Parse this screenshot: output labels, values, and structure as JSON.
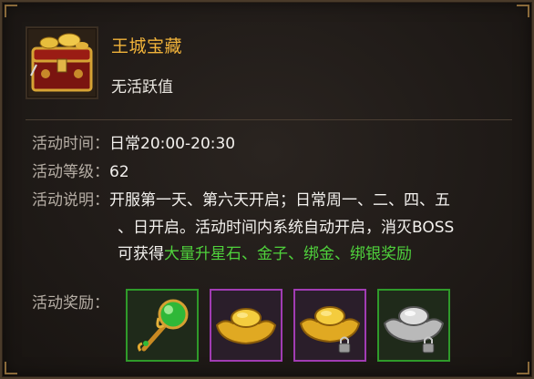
{
  "header": {
    "title": "王城宝藏",
    "subtitle": "无活跃值"
  },
  "details": {
    "time_label": "活动时间：",
    "time_value": "日常20:00-20:30",
    "level_label": "活动等级：",
    "level_value": "62",
    "desc_label": "活动说明：",
    "desc_line1": "开服第一天、第六天开启；日常周一、二、四、五",
    "desc_line2": "、日开启。活动时间内系统自动开启，消灭BOSS",
    "desc_line3_prefix": "可获得",
    "desc_line3_highlight": "大量升星石、金子、绑金、绑银奖励"
  },
  "rewards": {
    "label": "活动奖励：",
    "items": [
      {
        "icon": "green-gem-staff-icon",
        "frame_color": "#2f9a2a"
      },
      {
        "icon": "gold-ingot-icon",
        "frame_color": "#a13cb3"
      },
      {
        "icon": "bound-gold-ingot-icon",
        "frame_color": "#a13cb3"
      },
      {
        "icon": "bound-silver-ingot-icon",
        "frame_color": "#2f9a2a"
      }
    ]
  },
  "colors": {
    "title": "#f1b33a",
    "highlight": "#4fd23c",
    "label": "#b6aea5",
    "value": "#f3f1ee"
  }
}
